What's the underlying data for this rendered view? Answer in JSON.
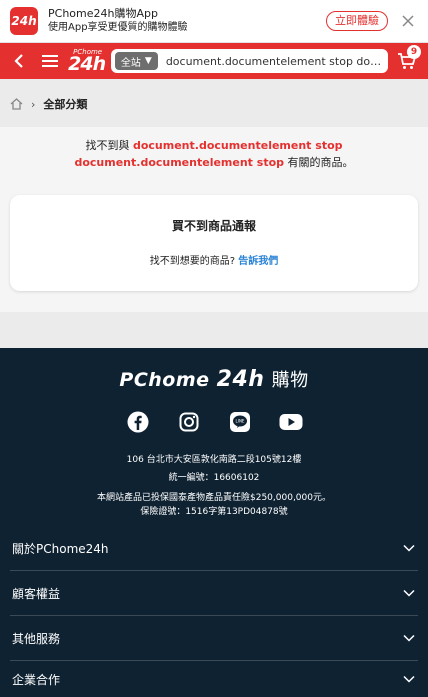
{
  "banner": {
    "logo_text": "24h",
    "title": "PChome24h購物App",
    "subtitle": "使用App享受更優質的購物體驗",
    "open_label": "立即體驗",
    "close_icon": "close-icon"
  },
  "header": {
    "logo_small": "PChome",
    "logo_num": "24h",
    "scope_label": "全站",
    "search_query": "document.documentelement stop docu···",
    "cart_count": "9",
    "brand_color": "#e4312f"
  },
  "breadcrumb": {
    "label": "全部分類"
  },
  "result": {
    "prefix": "找不到與",
    "keyword": "document.documentelement stop document.documentelement stop",
    "suffix": "有關的商品。"
  },
  "notify": {
    "title": "買不到商品通報",
    "text": "找不到想要的商品?",
    "link": "告訴我們"
  },
  "footer": {
    "logo_p": "PChome",
    "logo_24": "24h",
    "logo_shop": "購物",
    "address": "106 台北市大安區敦化南路二段105號12樓",
    "tax_id": "統一編號：16606102",
    "insurance_1": "本網站產品已投保國泰產物產品責任險$250,000,000元。",
    "insurance_2": "保險證號：1516字第13PD04878號",
    "sections": [
      {
        "label": "關於PChome24h"
      },
      {
        "label": "顧客權益"
      },
      {
        "label": "其他服務"
      },
      {
        "label": "企業合作"
      }
    ]
  }
}
